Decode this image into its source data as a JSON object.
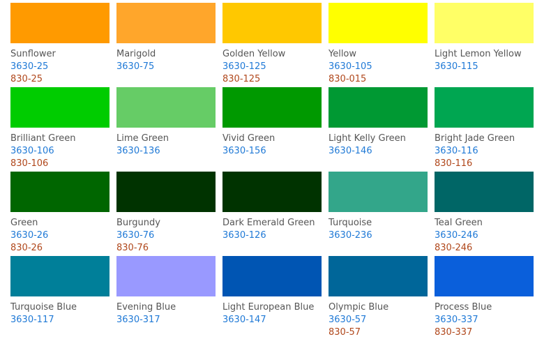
{
  "colors": [
    [
      {
        "name": "Sunflower",
        "code_a": "3630-25",
        "code_b": "830-25",
        "hex": "#ff9a00"
      },
      {
        "name": "Marigold",
        "code_a": "3630-75",
        "code_b": "",
        "hex": "#ffa62b"
      },
      {
        "name": "Golden Yellow",
        "code_a": "3630-125",
        "code_b": "830-125",
        "hex": "#ffc800"
      },
      {
        "name": "Yellow",
        "code_a": "3630-105",
        "code_b": "830-015",
        "hex": "#ffff00"
      },
      {
        "name": "Light Lemon Yellow",
        "code_a": "3630-115",
        "code_b": "",
        "hex": "#ffff66"
      }
    ],
    [
      {
        "name": "Brilliant Green",
        "code_a": "3630-106",
        "code_b": "830-106",
        "hex": "#00cc00"
      },
      {
        "name": "Lime Green",
        "code_a": "3630-136",
        "code_b": "",
        "hex": "#66cc66"
      },
      {
        "name": "Vivid Green",
        "code_a": "3630-156",
        "code_b": "",
        "hex": "#009900"
      },
      {
        "name": "Light Kelly Green",
        "code_a": "3630-146",
        "code_b": "",
        "hex": "#009933"
      },
      {
        "name": "Bright Jade Green",
        "code_a": "3630-116",
        "code_b": "830-116",
        "hex": "#00a651"
      }
    ],
    [
      {
        "name": "Green",
        "code_a": "3630-26",
        "code_b": "830-26",
        "hex": "#006600"
      },
      {
        "name": "Burgundy",
        "code_a": "3630-76",
        "code_b": "830-76",
        "hex": "#003300"
      },
      {
        "name": "Dark Emerald Green",
        "code_a": "3630-126",
        "code_b": "",
        "hex": "#003300"
      },
      {
        "name": "Turquoise",
        "code_a": "3630-236",
        "code_b": "",
        "hex": "#33a68a"
      },
      {
        "name": "Teal Green",
        "code_a": "3630-246",
        "code_b": "830-246",
        "hex": "#006666"
      }
    ],
    [
      {
        "name": "Turquoise Blue",
        "code_a": "3630-117",
        "code_b": "",
        "hex": "#007f99"
      },
      {
        "name": "Evening Blue",
        "code_a": "3630-317",
        "code_b": "",
        "hex": "#9999ff"
      },
      {
        "name": "Light European Blue",
        "code_a": "3630-147",
        "code_b": "",
        "hex": "#0055b3"
      },
      {
        "name": "Olympic Blue",
        "code_a": "3630-57",
        "code_b": "830-57",
        "hex": "#006699"
      },
      {
        "name": "Process Blue",
        "code_a": "3630-337",
        "code_b": "830-337",
        "hex": "#0a5fdb"
      }
    ]
  ]
}
